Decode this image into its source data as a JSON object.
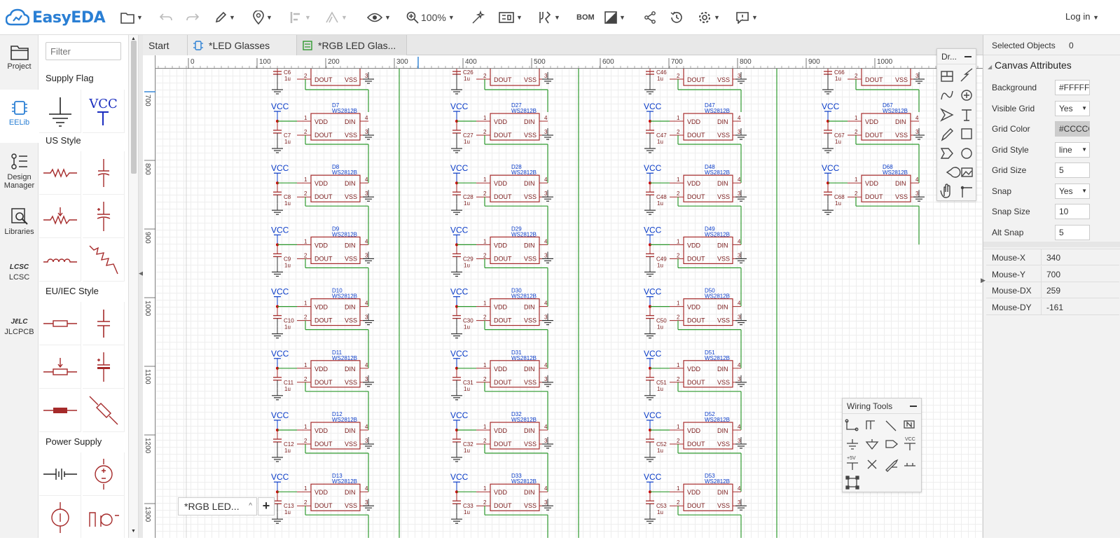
{
  "app": {
    "name": "EasyEDA",
    "login_label": "Log in",
    "zoom": "100%",
    "bom_label": "BOM"
  },
  "left_rail": {
    "items": [
      {
        "label": "Project",
        "icon": "folder-icon"
      },
      {
        "label": "EELib",
        "icon": "chip-icon"
      },
      {
        "label": "Design Manager",
        "icon": "list-icon"
      },
      {
        "label": "Libraries",
        "icon": "search-book-icon"
      },
      {
        "label": "LCSC",
        "icon": "lcsc-logo-icon"
      },
      {
        "label": "JLCPCB",
        "icon": "jlc-logo-icon"
      }
    ]
  },
  "library": {
    "filter_placeholder": "Filter",
    "sections": [
      "Supply Flag",
      "US Style",
      "EU/IEC Style",
      "Power Supply"
    ],
    "vcc_label": "VCC"
  },
  "tabs": [
    {
      "label": "Start"
    },
    {
      "label": "*LED Glasses"
    },
    {
      "label": "*RGB LED Glas..."
    }
  ],
  "ruler": {
    "top_ticks": [
      "0",
      "100",
      "200",
      "300",
      "400",
      "500",
      "600",
      "700",
      "800",
      "900",
      "1000"
    ],
    "left_ticks": [
      "700",
      "800",
      "900",
      "1000",
      "1100",
      "1200",
      "1300"
    ]
  },
  "schematic": {
    "chip_type": "WS2812B",
    "pin_vdd": "VDD",
    "pin_din": "DIN",
    "pin_dout": "DOUT",
    "pin_vss": "VSS",
    "cap_value": "1u",
    "vcc": "VCC",
    "columns": [
      {
        "cap_top": "C6",
        "leds": [
          "D7",
          "D8",
          "D9",
          "D10",
          "D11",
          "D12",
          "D13"
        ],
        "caps": [
          "C7",
          "C8",
          "C9",
          "C10",
          "C11",
          "C12",
          "C13"
        ]
      },
      {
        "cap_top": "C26",
        "leds": [
          "D27",
          "D28",
          "D29",
          "D30",
          "D31",
          "D32",
          "D33"
        ],
        "caps": [
          "C27",
          "C28",
          "C29",
          "C30",
          "C31",
          "C32",
          "C33"
        ]
      },
      {
        "cap_top": "C46",
        "leds": [
          "D47",
          "D48",
          "D49",
          "D50",
          "D51",
          "D52",
          "D53"
        ],
        "caps": [
          "C47",
          "C48",
          "C49",
          "C50",
          "C51",
          "C52",
          "C53"
        ]
      },
      {
        "cap_top": "C66",
        "leds": [
          "D67",
          "D68"
        ],
        "caps": [
          "C67",
          "C68"
        ]
      }
    ]
  },
  "drawing_tools": {
    "title": "Dr..."
  },
  "wiring_tools": {
    "title": "Wiring Tools"
  },
  "sheet_tab": {
    "label": "*RGB LED...",
    "add": "+"
  },
  "right_panel": {
    "selected_label": "Selected Objects",
    "selected_count": "0",
    "canvas_attributes": "Canvas Attributes",
    "rows": [
      {
        "label": "Background",
        "value": "#FFFFFF"
      },
      {
        "label": "Visible Grid",
        "value": "Yes"
      },
      {
        "label": "Grid Color",
        "value": "#CCCCCC"
      },
      {
        "label": "Grid Style",
        "value": "line"
      },
      {
        "label": "Grid Size",
        "value": "5"
      },
      {
        "label": "Snap",
        "value": "Yes"
      },
      {
        "label": "Snap Size",
        "value": "10"
      },
      {
        "label": "Alt Snap",
        "value": "5"
      }
    ],
    "mouse": [
      {
        "label": "Mouse-X",
        "value": "340"
      },
      {
        "label": "Mouse-Y",
        "value": "700"
      },
      {
        "label": "Mouse-DX",
        "value": "259"
      },
      {
        "label": "Mouse-DY",
        "value": "-161"
      }
    ]
  },
  "colors": {
    "accent": "#2a7fd4",
    "schematic_red": "#a52a2a",
    "wire_green": "#2e9a2e",
    "net_blue": "#0a3cc8"
  }
}
